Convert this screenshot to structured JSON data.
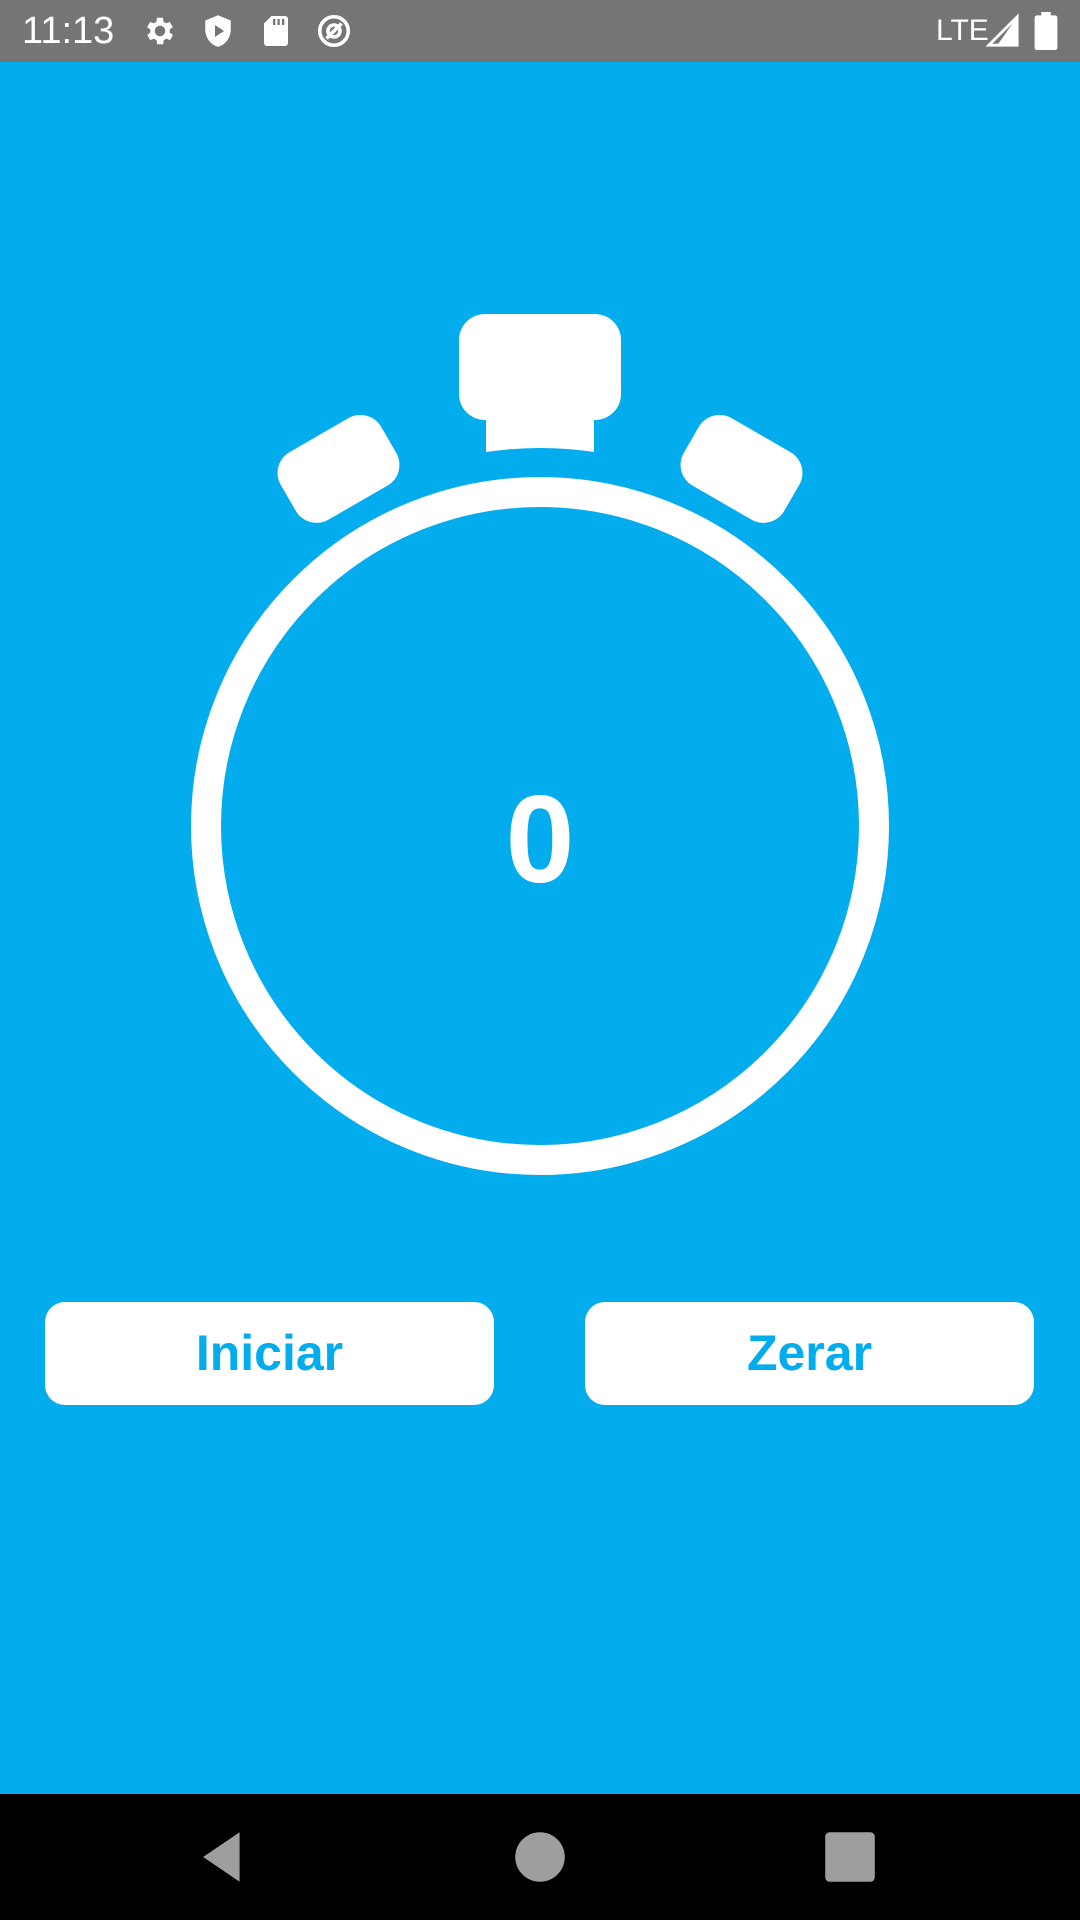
{
  "status_bar": {
    "time": "11:13",
    "network": "LTE",
    "icons": [
      "gear-icon",
      "shield-play-icon",
      "sd-card-icon",
      "at-sign-icon",
      "signal-icon",
      "battery-icon"
    ]
  },
  "stopwatch": {
    "value": "0"
  },
  "buttons": {
    "start_label": "Iniciar",
    "reset_label": "Zerar"
  },
  "nav": {
    "icons": [
      "back-icon",
      "home-icon",
      "recents-icon"
    ]
  },
  "colors": {
    "background": "#03aced",
    "status_bar": "#757575",
    "nav_bar": "#000000",
    "button_bg": "#ffffff",
    "button_text": "#03aced"
  }
}
